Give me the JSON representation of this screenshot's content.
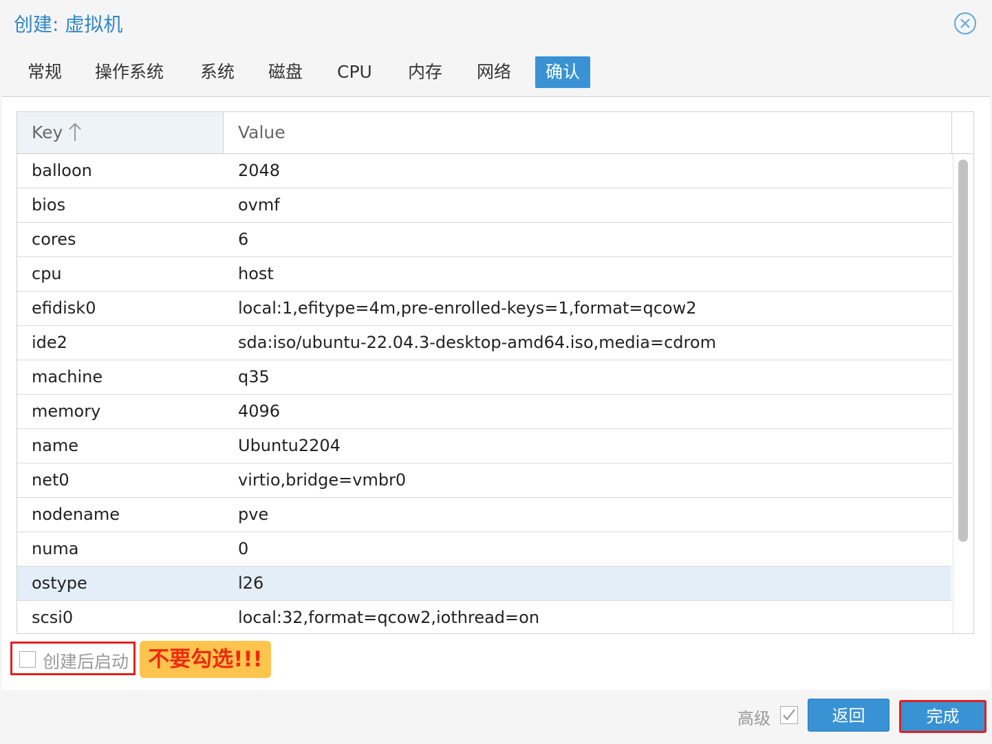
{
  "window": {
    "title": "创建: 虚拟机",
    "close_icon": "close-circle-icon"
  },
  "tabs": [
    {
      "label": "常规",
      "active": false
    },
    {
      "label": "操作系统",
      "active": false
    },
    {
      "label": "系统",
      "active": false
    },
    {
      "label": "磁盘",
      "active": false
    },
    {
      "label": "CPU",
      "active": false
    },
    {
      "label": "内存",
      "active": false
    },
    {
      "label": "网络",
      "active": false
    },
    {
      "label": "确认",
      "active": true
    }
  ],
  "grid": {
    "columns": {
      "key": "Key",
      "value": "Value"
    },
    "sort_icon": "arrow-up-icon",
    "rows": [
      {
        "key": "balloon",
        "value": "2048"
      },
      {
        "key": "bios",
        "value": "ovmf"
      },
      {
        "key": "cores",
        "value": "6"
      },
      {
        "key": "cpu",
        "value": "host"
      },
      {
        "key": "efidisk0",
        "value": "local:1,efitype=4m,pre-enrolled-keys=1,format=qcow2"
      },
      {
        "key": "ide2",
        "value": "sda:iso/ubuntu-22.04.3-desktop-amd64.iso,media=cdrom"
      },
      {
        "key": "machine",
        "value": "q35"
      },
      {
        "key": "memory",
        "value": "4096"
      },
      {
        "key": "name",
        "value": "Ubuntu2204"
      },
      {
        "key": "net0",
        "value": "virtio,bridge=vmbr0"
      },
      {
        "key": "nodename",
        "value": "pve"
      },
      {
        "key": "numa",
        "value": "0"
      },
      {
        "key": "ostype",
        "value": "l26",
        "selected": true
      },
      {
        "key": "scsi0",
        "value": "local:32,format=qcow2,iothread=on"
      }
    ]
  },
  "start_after_create": {
    "label": "创建后启动",
    "checked": false
  },
  "annotation": {
    "text": "不要勾选!!!",
    "bg": "#ffc44d",
    "color": "#ee2a10"
  },
  "footer": {
    "advanced_label": "高级",
    "advanced_checked": true,
    "back_label": "返回",
    "finish_label": "完成"
  },
  "colors": {
    "accent": "#3892d4",
    "highlight": "#e02020"
  }
}
